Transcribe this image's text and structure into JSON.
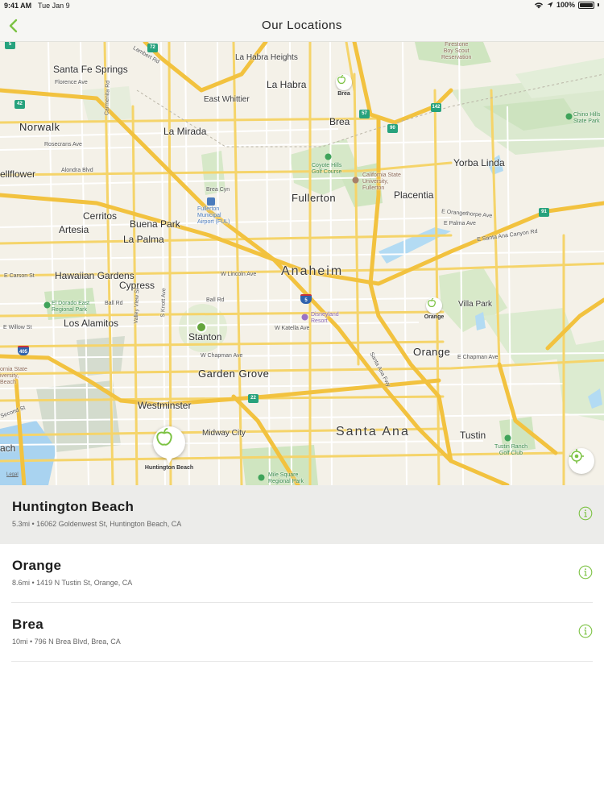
{
  "status_bar": {
    "time": "9:41 AM",
    "date": "Tue Jan 9",
    "battery": "100%"
  },
  "nav": {
    "title": "Our Locations",
    "back_icon": "chevron-left-icon",
    "accent": "#7cc243"
  },
  "map": {
    "cities": {
      "norwalk": "Norwalk",
      "la_mirada": "La Mirada",
      "la_habra": "La Habra",
      "brea": "Brea",
      "fullerton": "Fullerton",
      "placentia": "Placentia",
      "yorba_linda": "Yorba Linda",
      "cerritos": "Cerritos",
      "artesia": "Artesia",
      "buena_park": "Buena Park",
      "la_palma": "La Palma",
      "anaheim": "Anaheim",
      "hawaiian_gardens": "Hawaiian Gardens",
      "cypress": "Cypress",
      "los_alamitos": "Los Alamitos",
      "stanton": "Stanton",
      "garden_grove": "Garden Grove",
      "orange": "Orange",
      "villa_park": "Villa Park",
      "westminster": "Westminster",
      "midway_city": "Midway City",
      "santa_ana": "Santa Ana",
      "tustin": "Tustin",
      "santa_fe_springs": "Santa Fe Springs",
      "la_habra_heights": "La Habra Heights",
      "east_whittier": "East Whittier",
      "bellflower": "ellflower",
      "beach_edge": "ach"
    },
    "streets": {
      "florence_ave": "Florence Ave",
      "rosecrans_ave": "Rosecrans Ave",
      "alondra_blvd": "Alondra Blvd",
      "e_carson_st": "E Carson St",
      "ball_rd": "Ball Rd",
      "w_lincoln_ave": "W Lincoln Ave",
      "w_katella_ave": "W Katella Ave",
      "w_chapman_ave": "W Chapman Ave",
      "e_chapman_ave": "E Chapman Ave",
      "e_orangethorpe_ave": "E Orangethorpe Ave",
      "e_palma_ave": "E Palma Ave",
      "e_santa_ana_canyon_rd": "E Santa Ana Canyon Rd",
      "w_willow_st": "E Willow St",
      "santa_ana_fwy": "Santa Ana Fwy",
      "valley_view_st": "Valley View St",
      "s_knott_ave": "S Knott Ave",
      "carmenita_rd": "Carmenita Rd",
      "lambert_rd": "Lambert Rd",
      "brea_cyn": "Brea Cyn",
      "second_st": "Second St",
      "harbor": "Harbor",
      "euclid": "Euclid",
      "beach_blvd": "Beach Blvd",
      "s_harbor": "Harbor Blvd"
    },
    "pois": {
      "firestone": "Firestone\nBoy Scout\nReservation",
      "chino_hills": "Chino Hills\nState Park",
      "coyote_hills": "Coyote Hills\nGolf Course",
      "csuf": "California State\nUniversity,\nFullerton",
      "airport": "Fullerton\nMunicipal\nAirport (FUL)",
      "el_dorado": "El Dorado East\nRegional Park",
      "disneyland": "Disneyland\nResort",
      "tustin_ranch": "Tustin Ranch\nGolf Club",
      "mile_square": "Mile Square\nRegional Park",
      "cal_state_lb": "ornia State\niversity,\nBeach"
    },
    "shields": [
      "5",
      "72",
      "42",
      "57",
      "90",
      "142",
      "91",
      "22",
      "405",
      "5"
    ],
    "pins": [
      {
        "label": "Brea"
      },
      {
        "label": "Orange"
      },
      {
        "label": "Huntington Beach"
      }
    ],
    "legal": "Legal",
    "locate_icon": "location-target-icon"
  },
  "locations": [
    {
      "name": "Huntington Beach",
      "details": "5.3mi • 16062 Goldenwest St, Huntington Beach, CA",
      "selected": true
    },
    {
      "name": "Orange",
      "details": "8.6mi • 1419 N Tustin St, Orange, CA",
      "selected": false
    },
    {
      "name": "Brea",
      "details": "10mi • 796 N Brea Blvd, Brea, CA",
      "selected": false
    }
  ]
}
